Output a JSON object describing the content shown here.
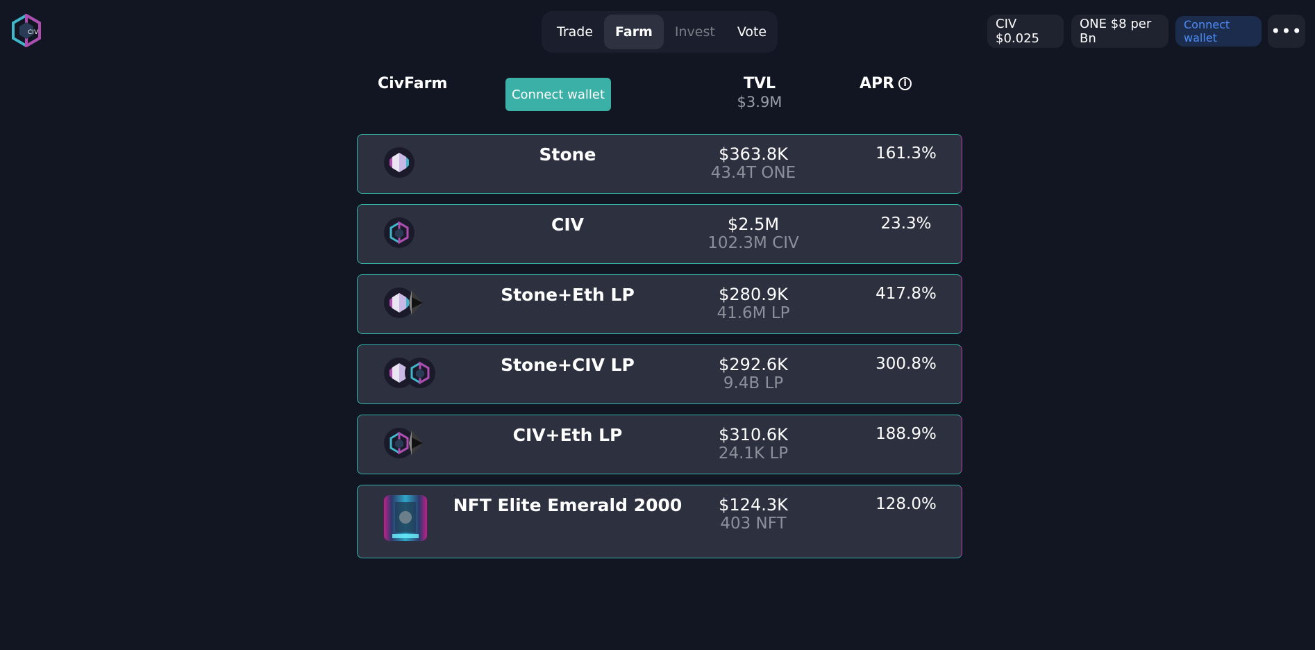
{
  "nav": {
    "tabs": [
      {
        "label": "Trade"
      },
      {
        "label": "Farm"
      },
      {
        "label": "Invest"
      },
      {
        "label": "Vote"
      }
    ]
  },
  "topbar": {
    "civ_price": "CIV $0.025",
    "one_price": "ONE $8 per Bn",
    "connect_wallet": "Connect wallet",
    "more": "•••"
  },
  "header": {
    "title": "CivFarm",
    "connect_wallet": "Connect wallet",
    "tvl_label": "TVL",
    "tvl_value": "$3.9M",
    "apr_label": "APR",
    "info_glyph": "i"
  },
  "farms": [
    {
      "name": "Stone",
      "tvl_usd": "$363.8K",
      "tvl_amount": "43.4T ONE",
      "apr": "161.3%",
      "icons": [
        "stone-icon"
      ]
    },
    {
      "name": "CIV",
      "tvl_usd": "$2.5M",
      "tvl_amount": "102.3M CIV",
      "apr": "23.3%",
      "icons": [
        "civ-icon"
      ]
    },
    {
      "name": "Stone+Eth LP",
      "tvl_usd": "$280.9K",
      "tvl_amount": "41.6M LP",
      "apr": "417.8%",
      "icons": [
        "stone-icon",
        "eth-icon"
      ]
    },
    {
      "name": "Stone+CIV LP",
      "tvl_usd": "$292.6K",
      "tvl_amount": "9.4B LP",
      "apr": "300.8%",
      "icons": [
        "stone-icon",
        "civ-icon"
      ]
    },
    {
      "name": "CIV+Eth LP",
      "tvl_usd": "$310.6K",
      "tvl_amount": "24.1K LP",
      "apr": "188.9%",
      "icons": [
        "civ-icon",
        "eth-icon"
      ]
    },
    {
      "name": "NFT Elite Emerald 2000",
      "tvl_usd": "$124.3K",
      "tvl_amount": "403 NFT",
      "apr": "128.0%",
      "icons": [
        "nft-image"
      ]
    }
  ],
  "colors": {
    "background": "#121623",
    "row_bg": "#2c303f",
    "accent_teal": "#3bb0a6",
    "accent_magenta": "#b04bb0",
    "wallet_blue": "#4d8cf5"
  }
}
